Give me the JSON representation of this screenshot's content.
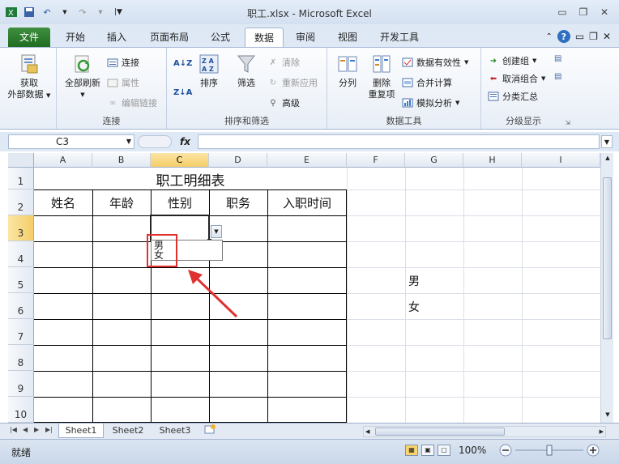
{
  "window": {
    "title": "职工.xlsx  -  Microsoft Excel"
  },
  "ribbon_tabs": [
    {
      "label": "文件"
    },
    {
      "label": "开始"
    },
    {
      "label": "插入"
    },
    {
      "label": "页面布局"
    },
    {
      "label": "公式"
    },
    {
      "label": "数据"
    },
    {
      "label": "审阅"
    },
    {
      "label": "视图"
    },
    {
      "label": "开发工具"
    }
  ],
  "ribbon": {
    "get_external_1": "获取",
    "get_external_2": "外部数据",
    "refresh_all": "全部刷新",
    "connections": "连接",
    "properties": "属性",
    "edit_links": "编辑链接",
    "group_connections": "连接",
    "sort": "排序",
    "filter": "筛选",
    "clear": "清除",
    "reapply": "重新应用",
    "advanced": "高级",
    "group_sort_filter": "排序和筛选",
    "text_to_columns": "分列",
    "remove_dup_1": "删除",
    "remove_dup_2": "重复项",
    "data_validation": "数据有效性",
    "consolidate": "合并计算",
    "what_if": "模拟分析",
    "group_data_tools": "数据工具",
    "group": "创建组",
    "ungroup": "取消组合",
    "subtotal": "分类汇总",
    "group_outline": "分级显示",
    "sort_az": "A↓Z",
    "sort_za": "Z↓A",
    "az_label": "A Z"
  },
  "formula_bar": {
    "name_box": "C3",
    "fx": "fx",
    "formula": ""
  },
  "columns": [
    "A",
    "B",
    "C",
    "D",
    "E",
    "F",
    "G",
    "H",
    "I"
  ],
  "rows": [
    "1",
    "2",
    "3",
    "4",
    "5",
    "6",
    "7",
    "8",
    "9",
    "10"
  ],
  "cells": {
    "title": "职工明细表",
    "h_name": "姓名",
    "h_age": "年龄",
    "h_gender": "性别",
    "h_job": "职务",
    "h_join": "入职时间",
    "g5": "男",
    "g6": "女"
  },
  "dropdown": {
    "options": [
      "男",
      "女"
    ]
  },
  "sheet_tabs": [
    {
      "label": "Sheet1"
    },
    {
      "label": "Sheet2"
    },
    {
      "label": "Sheet3"
    }
  ],
  "status": {
    "ready": "就绪",
    "zoom": "100%"
  },
  "colors": {
    "file_tab": "#2d7d2d",
    "annotation": "#e03030"
  }
}
